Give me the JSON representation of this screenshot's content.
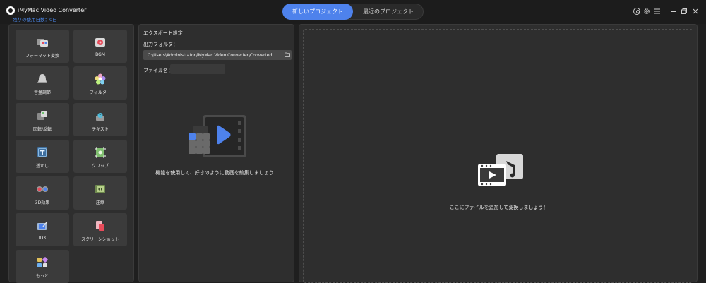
{
  "app": {
    "title": "iMyMac Video Converter",
    "trial_text": "残りの使用日数：0日"
  },
  "header": {
    "tabs": [
      {
        "label": "新しいプロジェクト",
        "active": true
      },
      {
        "label": "最近のプロジェクト",
        "active": false
      }
    ]
  },
  "tools": [
    {
      "label": "フォーマット変換",
      "icon": "format-convert-icon"
    },
    {
      "label": "BGM",
      "icon": "bgm-icon"
    },
    {
      "label": "音量調節",
      "icon": "volume-icon"
    },
    {
      "label": "フィルター",
      "icon": "filter-icon"
    },
    {
      "label": "回転/反転",
      "icon": "rotate-icon"
    },
    {
      "label": "テキスト",
      "icon": "text-icon"
    },
    {
      "label": "透かし",
      "icon": "watermark-icon"
    },
    {
      "label": "クリップ",
      "icon": "clip-icon"
    },
    {
      "label": "3D効果",
      "icon": "3d-glasses-icon"
    },
    {
      "label": "圧縮",
      "icon": "compress-icon"
    },
    {
      "label": "ID3",
      "icon": "id3-icon"
    },
    {
      "label": "スクリーンショット",
      "icon": "screenshot-icon"
    },
    {
      "label": "もっと",
      "icon": "more-icon"
    }
  ],
  "export": {
    "title": "エクスポート設定",
    "folder_label": "出力フォルダ：",
    "folder_path": "C:\\Users\\Administrator\\iMyMac Video Converter\\Converted",
    "filename_label": "ファイル名：",
    "filename_value": "",
    "hint": "機能を使用して、好きのように動画を編集しましょう！"
  },
  "dropzone": {
    "hint": "ここにファイルを追加して変換しましょう！"
  },
  "colors": {
    "accent": "#4e82ec",
    "trial": "#4e8df2",
    "background": "#1f1f1f",
    "panel": "#2e2e2e",
    "tool_tile": "#3b3b3b"
  }
}
